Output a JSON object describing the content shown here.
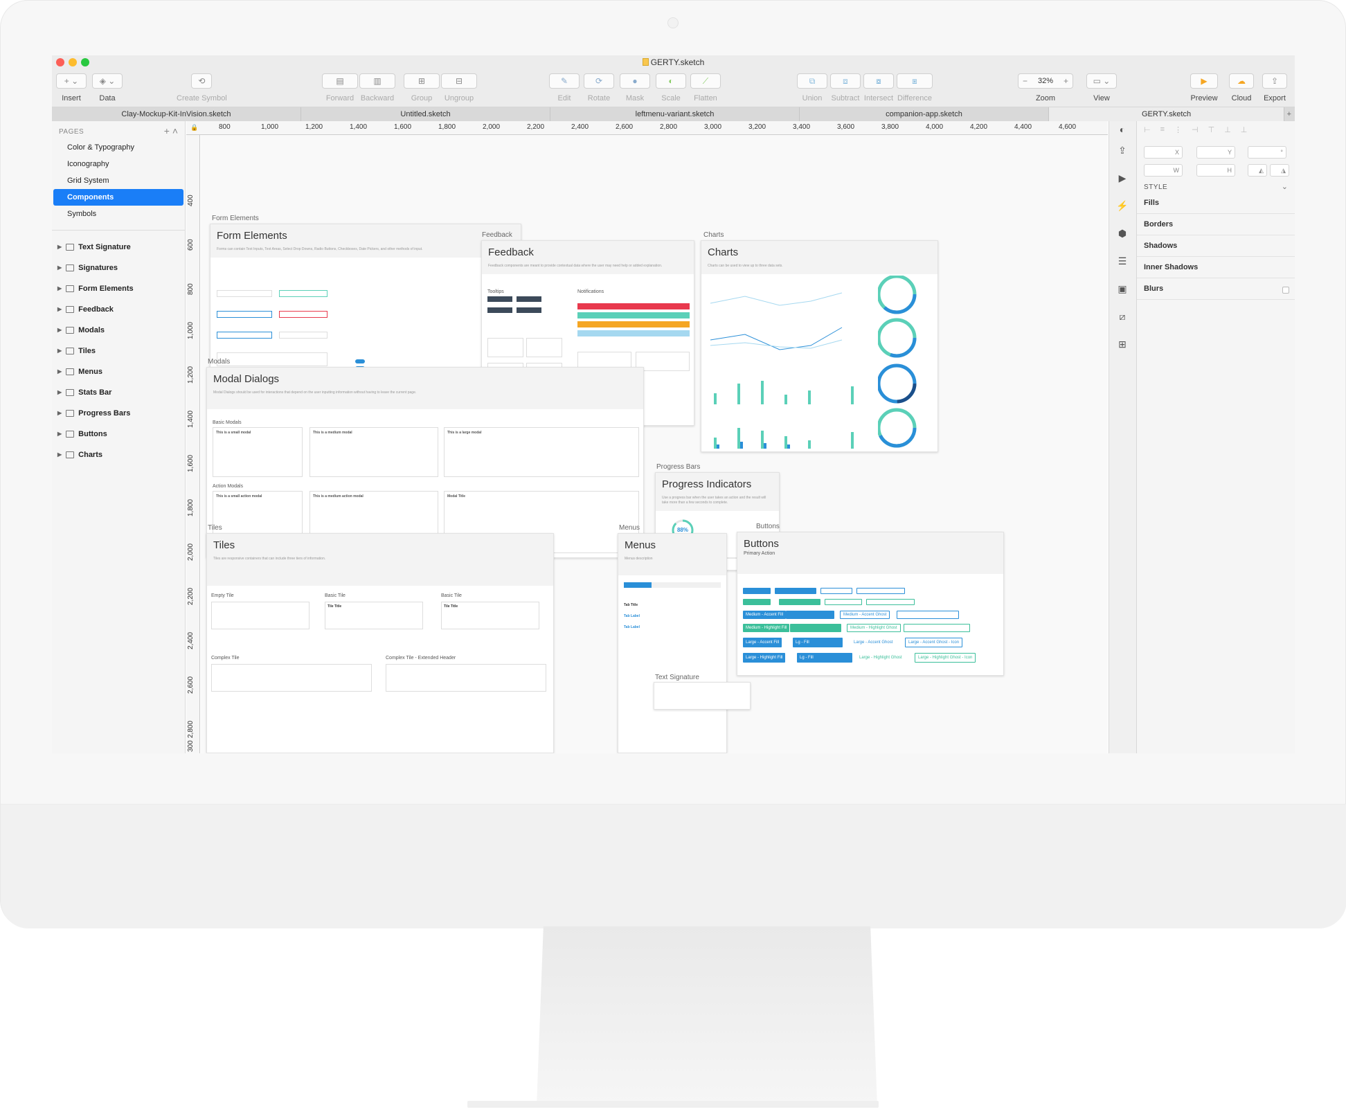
{
  "window": {
    "title": "GERTY.sketch"
  },
  "toolbar": {
    "insert": "Insert",
    "data": "Data",
    "create_symbol": "Create Symbol",
    "forward": "Forward",
    "backward": "Backward",
    "group": "Group",
    "ungroup": "Ungroup",
    "edit": "Edit",
    "rotate": "Rotate",
    "mask": "Mask",
    "scale": "Scale",
    "flatten": "Flatten",
    "union": "Union",
    "subtract": "Subtract",
    "intersect": "Intersect",
    "difference": "Difference",
    "zoom_label": "Zoom",
    "zoom_value": "32%",
    "view": "View",
    "preview": "Preview",
    "cloud": "Cloud",
    "export": "Export"
  },
  "tabs": [
    "Clay-Mockup-Kit-InVision.sketch",
    "Untitled.sketch",
    "leftmenu-variant.sketch",
    "companion-app.sketch",
    "GERTY.sketch"
  ],
  "sidebar": {
    "pages_header": "PAGES",
    "pages": [
      "Color & Typography",
      "Iconography",
      "Grid System",
      "Components",
      "Symbols"
    ],
    "active_page": "Components",
    "layers": [
      "Text Signature",
      "Signatures",
      "Form Elements",
      "Feedback",
      "Modals",
      "Tiles",
      "Menus",
      "Stats Bar",
      "Progress Bars",
      "Buttons",
      "Charts"
    ]
  },
  "rulers": {
    "top": [
      "800",
      "1,000",
      "1,200",
      "1,400",
      "1,600",
      "1,800",
      "2,000",
      "2,200",
      "2,400",
      "2,600",
      "2,800",
      "3,000",
      "3,200",
      "3,400",
      "3,600",
      "3,800",
      "4,000",
      "4,200",
      "4,400",
      "4,600"
    ],
    "left": [
      "400",
      "600",
      "800",
      "1,000",
      "1,200",
      "1,400",
      "1,600",
      "1,800",
      "2,000",
      "2,200",
      "2,400",
      "2,600",
      "2,800",
      "300"
    ]
  },
  "artboards": {
    "form_elements": {
      "label": "Form Elements",
      "title": "Form Elements",
      "desc": "Forms can contain Text Inputs, Text Areas, Select Drop Downs, Radio Buttons, Checkboxes, Date Pickers, and other methods of input."
    },
    "feedback": {
      "label": "Feedback",
      "title": "Feedback",
      "desc": "Feedback components are meant to provide contextual data where the user may need help or added explanation.",
      "tooltips": "Tooltips",
      "notifications": "Notifications"
    },
    "charts": {
      "label": "Charts",
      "title": "Charts",
      "desc": "Charts can be used to view up to three data sets."
    },
    "modals": {
      "label": "Modals",
      "title": "Modal Dialogs",
      "desc": "Modal Dialogs should be used for interactions that depend on the user inputting information without having to leave the current page.",
      "basic": "Basic Modals",
      "action": "Action Modals",
      "small": "This is a small modal",
      "medium": "This is a medium modal",
      "large": "This is a large modal",
      "small_action": "This is a small action modal",
      "medium_action": "This is a medium action modal",
      "modal_title": "Modal Title"
    },
    "progress": {
      "label": "Progress Bars",
      "title": "Progress Indicators",
      "desc": "Use a progress bar when the user takes an action and the result will take more than a few seconds to complete.",
      "value": "88%"
    },
    "tiles": {
      "label": "Tiles",
      "title": "Tiles",
      "desc": "Tiles are responsive containers that can include three tiers of information.",
      "empty": "Empty Tile",
      "basic": "Basic Tile",
      "basic2": "Basic Tile",
      "complex": "Complex Tile",
      "complex_ext": "Complex Tile - Extended Header",
      "tile_title": "Tile Title"
    },
    "menus": {
      "label": "Menus",
      "title": "Menus",
      "desc": "Menus description",
      "tab_title": "Tab Title",
      "tab_label": "Tab Label"
    },
    "buttons": {
      "label": "Buttons",
      "title": "Buttons",
      "primary": "Primary Action",
      "large_accent": "Large - Accent Fill",
      "lg_fill": "Lg - Fill",
      "large_ghost": "Large - Accent Ghost",
      "large_ghost_icon": "Large - Accent Ghost - Icon",
      "large_highlight": "Large - Highlight Fill",
      "large_highlight_ghost": "Large - Highlight Ghost",
      "large_highlight_ghost_icon": "Large - Highlight Ghost - Icon",
      "medium_accent": "Medium - Accent Fill",
      "medium_highlight": "Medium - Highlight Fill",
      "medium_ghost": "Medium - Accent Ghost",
      "medium_highlight_ghost": "Medium - Highlight Ghost"
    },
    "text_signature": {
      "label": "Text Signature"
    }
  },
  "inspector": {
    "x": "X",
    "y": "Y",
    "w": "W",
    "h": "H",
    "style_header": "STYLE",
    "rows": [
      "Fills",
      "Borders",
      "Shadows",
      "Inner Shadows",
      "Blurs"
    ]
  },
  "colors": {
    "accent": "#1a7ef7",
    "teal": "#5bd0b8",
    "blue": "#2a8fd8",
    "red": "#e8394d",
    "orange": "#f5a623"
  }
}
